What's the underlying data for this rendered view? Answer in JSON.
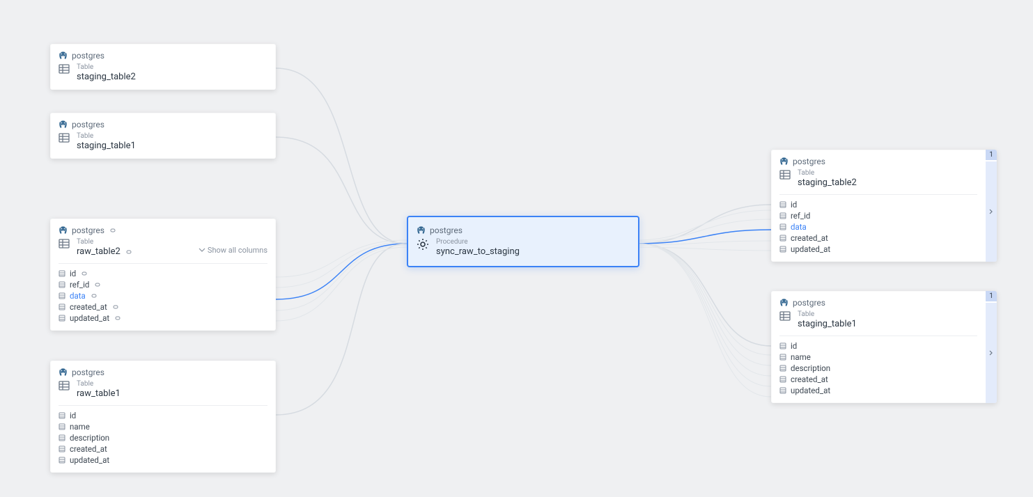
{
  "db": "postgres",
  "kinds": {
    "table": "Table",
    "procedure": "Procedure"
  },
  "show_all": "Show all columns",
  "center": {
    "name": "sync_raw_to_staging"
  },
  "left": {
    "n1": {
      "name": "staging_table2"
    },
    "n2": {
      "name": "staging_table1"
    },
    "n3": {
      "name": "raw_table2",
      "cols": [
        {
          "n": "id",
          "link": false
        },
        {
          "n": "ref_id",
          "link": false
        },
        {
          "n": "data",
          "link": true
        },
        {
          "n": "created_at",
          "link": false
        },
        {
          "n": "updated_at",
          "link": false
        }
      ]
    },
    "n4": {
      "name": "raw_table1",
      "cols": [
        {
          "n": "id"
        },
        {
          "n": "name"
        },
        {
          "n": "description"
        },
        {
          "n": "created_at"
        },
        {
          "n": "updated_at"
        }
      ]
    }
  },
  "right": {
    "n5": {
      "name": "staging_table2",
      "badge": "1",
      "cols": [
        {
          "n": "id"
        },
        {
          "n": "ref_id"
        },
        {
          "n": "data",
          "link": true
        },
        {
          "n": "created_at"
        },
        {
          "n": "updated_at"
        }
      ]
    },
    "n6": {
      "name": "staging_table1",
      "badge": "1",
      "cols": [
        {
          "n": "id"
        },
        {
          "n": "name"
        },
        {
          "n": "description"
        },
        {
          "n": "created_at"
        },
        {
          "n": "updated_at"
        }
      ]
    }
  }
}
